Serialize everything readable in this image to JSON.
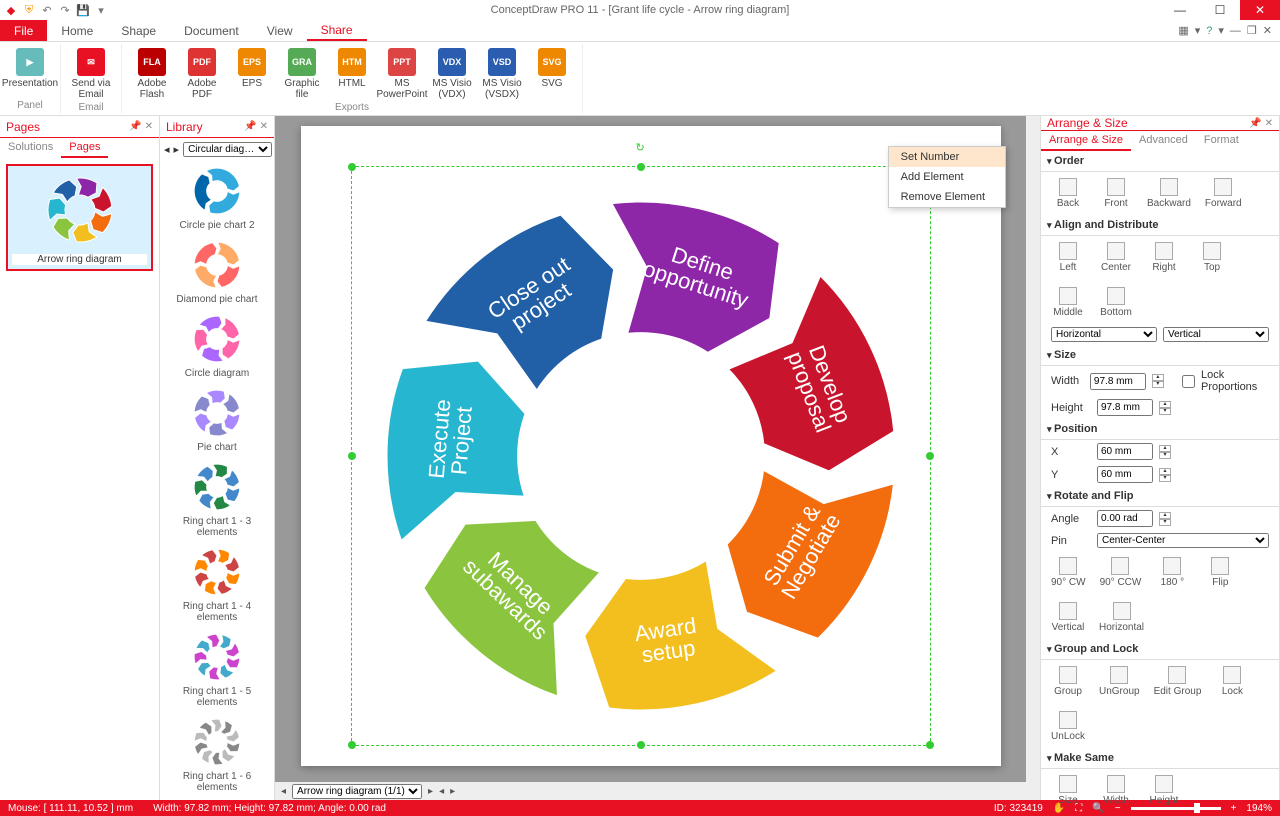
{
  "app_title": "ConceptDraw PRO 11 - [Grant life cycle - Arrow ring diagram]",
  "ribbon_tabs": {
    "file": "File",
    "items": [
      "Home",
      "Shape",
      "Document",
      "View",
      "Share"
    ],
    "active": 4
  },
  "ribbon": {
    "panel": {
      "presentation": "Presentation",
      "label": "Panel"
    },
    "email": {
      "send": "Send via Email",
      "label": "Email"
    },
    "exports": {
      "label": "Exports",
      "items": [
        {
          "k": "flash",
          "t": "Adobe Flash",
          "c": "#b00"
        },
        {
          "k": "pdf",
          "t": "Adobe PDF",
          "c": "#d33"
        },
        {
          "k": "eps",
          "t": "EPS",
          "c": "#e80"
        },
        {
          "k": "graphic",
          "t": "Graphic file",
          "c": "#5a5"
        },
        {
          "k": "html",
          "t": "HTML",
          "c": "#e80"
        },
        {
          "k": "ppt",
          "t": "MS PowerPoint",
          "c": "#d44"
        },
        {
          "k": "vdx",
          "t": "MS Visio (VDX)",
          "c": "#2a5db0"
        },
        {
          "k": "vsdx",
          "t": "MS Visio (VSDX)",
          "c": "#2a5db0"
        },
        {
          "k": "svg",
          "t": "SVG",
          "c": "#e80"
        }
      ]
    }
  },
  "pages_panel": {
    "title": "Pages",
    "tabs": [
      "Solutions",
      "Pages"
    ],
    "active_tab": 1,
    "thumb_caption": "Arrow ring diagram"
  },
  "library_panel": {
    "title": "Library",
    "dropdown": "Circular diag…",
    "items": [
      "Circle pie chart 2",
      "Diamond pie chart",
      "Circle diagram",
      "Pie chart",
      "Ring chart 1 - 3 elements",
      "Ring chart 1 - 4 elements",
      "Ring chart 1 - 5 elements",
      "Ring chart 1 - 6 elements"
    ]
  },
  "context_menu": [
    "Set Number",
    "Add Element",
    "Remove Element"
  ],
  "arrange_panel": {
    "title": "Arrange & Size",
    "tabs": [
      "Arrange & Size",
      "Advanced",
      "Format"
    ],
    "order": {
      "h": "Order",
      "items": [
        "Back",
        "Front",
        "Backward",
        "Forward"
      ]
    },
    "align": {
      "h": "Align and Distribute",
      "items": [
        "Left",
        "Center",
        "Right",
        "Top",
        "Middle",
        "Bottom"
      ],
      "horiz": "Horizontal",
      "vert": "Vertical"
    },
    "size": {
      "h": "Size",
      "width_l": "Width",
      "width": "97.8 mm",
      "height_l": "Height",
      "height": "97.8 mm",
      "lock": "Lock Proportions"
    },
    "position": {
      "h": "Position",
      "x_l": "X",
      "x": "60 mm",
      "y_l": "Y",
      "y": "60 mm"
    },
    "rotate": {
      "h": "Rotate and Flip",
      "angle_l": "Angle",
      "angle": "0.00 rad",
      "pin_l": "Pin",
      "pin": "Center-Center",
      "items": [
        "90° CW",
        "90° CCW",
        "180 °",
        "Flip",
        "Vertical",
        "Horizontal"
      ]
    },
    "group": {
      "h": "Group and Lock",
      "items": [
        "Group",
        "UnGroup",
        "Edit Group",
        "Lock",
        "UnLock"
      ]
    },
    "make": {
      "h": "Make Same",
      "items": [
        "Size",
        "Width",
        "Height"
      ]
    }
  },
  "page_tabs": "Arrow ring diagram (1/1)",
  "status": {
    "mouse": "Mouse: [ 111.11, 10.52 ] mm",
    "size": "Width: 97.82 mm;   Height: 97.82 mm;   Angle: 0.00 rad",
    "id": "ID: 323419",
    "zoom": "194%"
  },
  "chart_data": {
    "type": "pie",
    "title": "Grant life cycle",
    "style": "arrow-ring-donut",
    "segments_count": 7,
    "inner_radius_ratio": 0.48,
    "rotation_deg": -98,
    "series": [
      {
        "name": "Define opportunity",
        "value": 1,
        "color": "#8e26a8"
      },
      {
        "name": "Develop proposal",
        "value": 1,
        "color": "#c8152d"
      },
      {
        "name": "Submit & Negotiate",
        "value": 1,
        "color": "#f36c0e"
      },
      {
        "name": "Award setup",
        "value": 1,
        "color": "#f3bf1e"
      },
      {
        "name": "Manage subawards",
        "value": 1,
        "color": "#8bc53f"
      },
      {
        "name": "Execute Project",
        "value": 1,
        "color": "#27b6cf"
      },
      {
        "name": "Close out project",
        "value": 1,
        "color": "#215fa6"
      }
    ]
  }
}
